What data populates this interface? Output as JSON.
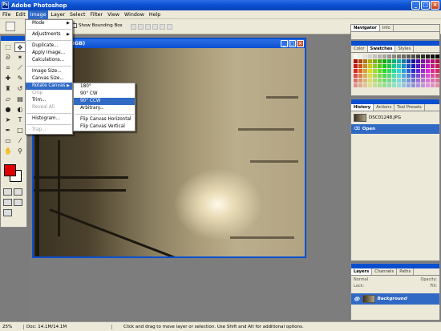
{
  "app": {
    "title": "Adobe Photoshop"
  },
  "menubar": [
    "File",
    "Edit",
    "Image",
    "Layer",
    "Select",
    "Filter",
    "View",
    "Window",
    "Help"
  ],
  "options": {
    "show_bounding_box": "Show Bounding Box"
  },
  "document": {
    "title": "PG @ 25% (RGB)"
  },
  "image_menu": {
    "items": [
      "Mode",
      "Adjustments",
      "Duplicate...",
      "Apply Image...",
      "Calculations...",
      "Image Size...",
      "Canvas Size...",
      "Rotate Canvas",
      "Crop",
      "Trim...",
      "Reveal All",
      "Histogram...",
      "Trap..."
    ]
  },
  "rotate_menu": {
    "items": [
      "180°",
      "90° CW",
      "90° CCW",
      "Arbitrary...",
      "Flip Canvas Horizontal",
      "Flip Canvas Vertical"
    ]
  },
  "navigator": {
    "tabs": [
      "Navigator",
      "Info"
    ]
  },
  "swatches": {
    "tabs": [
      "Color",
      "Swatches",
      "Styles"
    ]
  },
  "history": {
    "tabs": [
      "History",
      "Actions",
      "Tool Presets"
    ],
    "snapshot": "DSC01248.JPG",
    "state": "Open"
  },
  "layers": {
    "tabs": [
      "Layers",
      "Channels",
      "Paths"
    ],
    "blend_mode": "Normal",
    "opacity_label": "Opacity:",
    "lock_label": "Lock:",
    "fill_label": "Fill:",
    "layer_name": "Background"
  },
  "status": {
    "zoom": "25%",
    "doc_size": "Doc: 14.1M/14.1M",
    "message": "Click and drag to move layer or selection. Use Shift and Alt for additional options."
  },
  "colors": {
    "foreground": "#e00000",
    "background": "#ffffff",
    "highlight": "#316ac5",
    "titlebar": "#0a4fd0"
  },
  "icons": [
    "move-icon",
    "marquee-icon",
    "lasso-icon",
    "magic-wand-icon",
    "crop-icon",
    "slice-icon",
    "healing-icon",
    "brush-icon",
    "stamp-icon",
    "history-brush-icon",
    "eraser-icon",
    "gradient-icon",
    "blur-icon",
    "dodge-icon",
    "path-select-icon",
    "type-icon",
    "pen-icon",
    "shape-icon",
    "notes-icon",
    "eyedropper-icon",
    "hand-icon",
    "zoom-icon"
  ]
}
